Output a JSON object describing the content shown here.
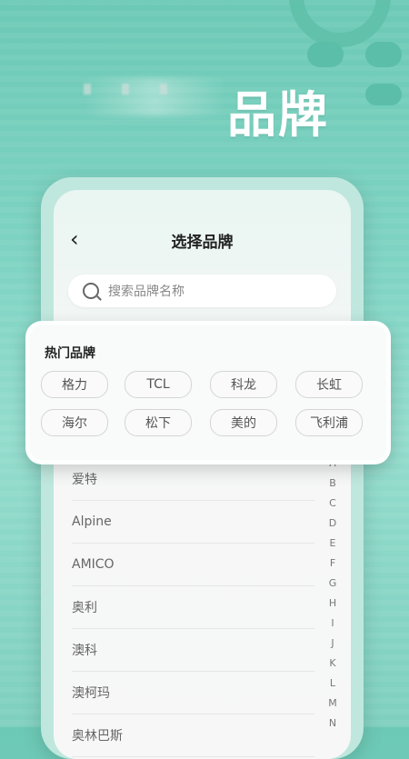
{
  "hero": {
    "title": "品牌"
  },
  "screen": {
    "back": "‹",
    "title": "选择品牌",
    "search_placeholder": "搜索品牌名称"
  },
  "hot_brands": {
    "title": "热门品牌",
    "chips": [
      "格力",
      "TCL",
      "科龙",
      "长虹",
      "海尔",
      "松下",
      "美的",
      "飞利浦"
    ]
  },
  "brand_list": [
    "爱特",
    "Alpine",
    "AMICO",
    "奥利",
    "澳科",
    "澳柯玛",
    "奥林巴斯"
  ],
  "index_letters": [
    "A",
    "B",
    "C",
    "D",
    "E",
    "F",
    "G",
    "H",
    "I",
    "J",
    "K",
    "L",
    "M",
    "N"
  ],
  "colors": {
    "bg": "#7ed3c2",
    "accent": "#5fc0aa"
  }
}
